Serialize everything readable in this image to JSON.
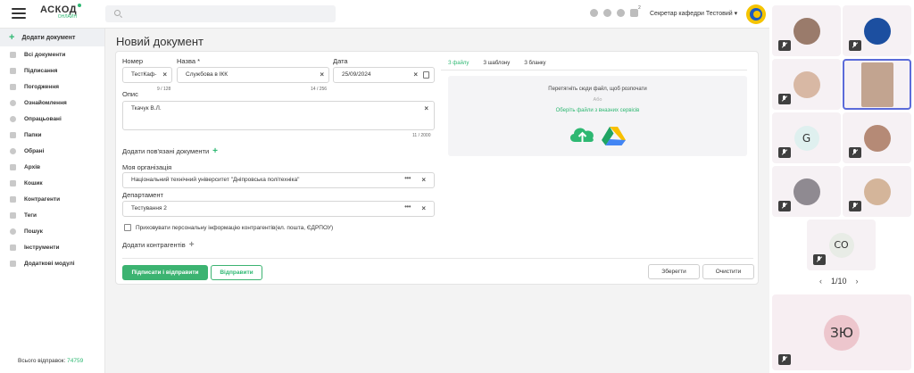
{
  "app": {
    "logo_main": "АСКОД",
    "logo_sub": "ОНЛАЙН",
    "notif_count": "2",
    "user_name": "Секретар кафедри Тестовий"
  },
  "sidebar": {
    "add_label": "Додати документ",
    "items": [
      {
        "label": "Всі документи",
        "icon": "documents-icon"
      },
      {
        "label": "Підписання",
        "icon": "sign-icon"
      },
      {
        "label": "Погодження",
        "icon": "approve-icon"
      },
      {
        "label": "Ознайомлення",
        "icon": "eye-icon"
      },
      {
        "label": "Опрацьовані",
        "icon": "check-circle-icon"
      },
      {
        "label": "Папки",
        "icon": "folder-icon"
      },
      {
        "label": "Обрані",
        "icon": "star-icon"
      },
      {
        "label": "Архів",
        "icon": "archive-icon"
      },
      {
        "label": "Кошик",
        "icon": "trash-icon"
      },
      {
        "label": "Контрагенти",
        "icon": "contacts-icon"
      },
      {
        "label": "Теги",
        "icon": "tag-icon"
      },
      {
        "label": "Пошук",
        "icon": "search-icon"
      },
      {
        "label": "Інструменти",
        "icon": "wrench-icon"
      },
      {
        "label": "Додаткові модулі",
        "icon": "modules-icon"
      }
    ],
    "footer_label": "Всього відправок:",
    "footer_value": "74759"
  },
  "page": {
    "title": "Новий документ"
  },
  "form": {
    "number_label": "Номер",
    "number_value": "ТестКаф-",
    "number_counter": "9 / 128",
    "name_label": "Назва *",
    "name_value": "Службова в ІКК",
    "name_counter": "14 / 256",
    "date_label": "Дата",
    "date_value": "25/09/2024",
    "desc_label": "Опис",
    "desc_value": "Ткачук В.Л.",
    "desc_counter": "11 / 2000",
    "related_label": "Додати пов'язані документи",
    "org_label": "Моя організація",
    "org_value": "Національний технічний університет \"Дніпровська політехніка\"",
    "dept_label": "Департамент",
    "dept_value": "Тестування 2",
    "hide_label": "Приховувати персональну інформацію контрагентів(ел. пошта, ЄДРПОУ)",
    "contractors_label": "Додати контрагентів",
    "sign_send_label": "Підписати і відправити",
    "send_label": "Відправити",
    "save_label": "Зберегти",
    "clear_label": "Очистити"
  },
  "upload": {
    "tabs": [
      "З файлу",
      "З шаблону",
      "З бланку"
    ],
    "active_tab": 0,
    "drop_title": "Перетягніть сюди файл, щоб розпочати",
    "or_label": "Або",
    "services_label": "Оберіть файли з вназних сервісів"
  },
  "video": {
    "tiles_left": [
      "person",
      "person",
      "G",
      "person",
      "CO"
    ],
    "letter_g": "G",
    "letter_co": "СО",
    "letter_zu": "ЗЮ",
    "pager": "1/10"
  },
  "colors": {
    "accent": "#2eb872",
    "selected_tile": "#5b6bd9"
  }
}
